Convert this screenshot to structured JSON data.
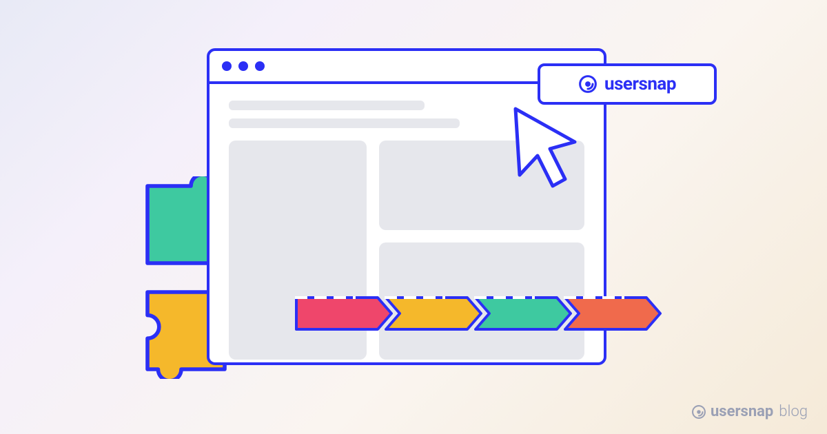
{
  "button": {
    "label": "usersnap"
  },
  "watermark": {
    "brand": "usersnap",
    "sub": "blog"
  },
  "colors": {
    "primary": "#2b2ff5",
    "pipeline": [
      "#ef466b",
      "#f5b82b",
      "#3ec9a0",
      "#f06a4c"
    ]
  },
  "icons": {
    "button_logo": "usersnap-logo-icon",
    "cursor": "cursor-arrow-icon",
    "puzzle_top": "puzzle-piece-icon",
    "puzzle_bottom": "puzzle-piece-icon",
    "watermark_logo": "usersnap-logo-icon"
  }
}
